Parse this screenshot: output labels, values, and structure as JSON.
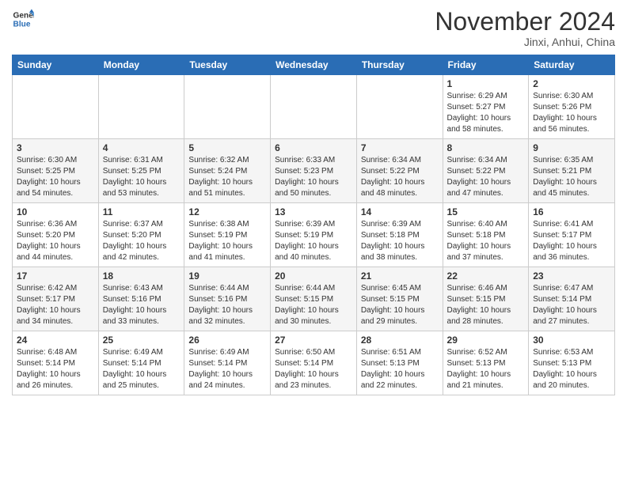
{
  "header": {
    "logo_line1": "General",
    "logo_line2": "Blue",
    "month": "November 2024",
    "location": "Jinxi, Anhui, China"
  },
  "weekdays": [
    "Sunday",
    "Monday",
    "Tuesday",
    "Wednesday",
    "Thursday",
    "Friday",
    "Saturday"
  ],
  "weeks": [
    [
      {
        "day": "",
        "info": ""
      },
      {
        "day": "",
        "info": ""
      },
      {
        "day": "",
        "info": ""
      },
      {
        "day": "",
        "info": ""
      },
      {
        "day": "",
        "info": ""
      },
      {
        "day": "1",
        "info": "Sunrise: 6:29 AM\nSunset: 5:27 PM\nDaylight: 10 hours\nand 58 minutes."
      },
      {
        "day": "2",
        "info": "Sunrise: 6:30 AM\nSunset: 5:26 PM\nDaylight: 10 hours\nand 56 minutes."
      }
    ],
    [
      {
        "day": "3",
        "info": "Sunrise: 6:30 AM\nSunset: 5:25 PM\nDaylight: 10 hours\nand 54 minutes."
      },
      {
        "day": "4",
        "info": "Sunrise: 6:31 AM\nSunset: 5:25 PM\nDaylight: 10 hours\nand 53 minutes."
      },
      {
        "day": "5",
        "info": "Sunrise: 6:32 AM\nSunset: 5:24 PM\nDaylight: 10 hours\nand 51 minutes."
      },
      {
        "day": "6",
        "info": "Sunrise: 6:33 AM\nSunset: 5:23 PM\nDaylight: 10 hours\nand 50 minutes."
      },
      {
        "day": "7",
        "info": "Sunrise: 6:34 AM\nSunset: 5:22 PM\nDaylight: 10 hours\nand 48 minutes."
      },
      {
        "day": "8",
        "info": "Sunrise: 6:34 AM\nSunset: 5:22 PM\nDaylight: 10 hours\nand 47 minutes."
      },
      {
        "day": "9",
        "info": "Sunrise: 6:35 AM\nSunset: 5:21 PM\nDaylight: 10 hours\nand 45 minutes."
      }
    ],
    [
      {
        "day": "10",
        "info": "Sunrise: 6:36 AM\nSunset: 5:20 PM\nDaylight: 10 hours\nand 44 minutes."
      },
      {
        "day": "11",
        "info": "Sunrise: 6:37 AM\nSunset: 5:20 PM\nDaylight: 10 hours\nand 42 minutes."
      },
      {
        "day": "12",
        "info": "Sunrise: 6:38 AM\nSunset: 5:19 PM\nDaylight: 10 hours\nand 41 minutes."
      },
      {
        "day": "13",
        "info": "Sunrise: 6:39 AM\nSunset: 5:19 PM\nDaylight: 10 hours\nand 40 minutes."
      },
      {
        "day": "14",
        "info": "Sunrise: 6:39 AM\nSunset: 5:18 PM\nDaylight: 10 hours\nand 38 minutes."
      },
      {
        "day": "15",
        "info": "Sunrise: 6:40 AM\nSunset: 5:18 PM\nDaylight: 10 hours\nand 37 minutes."
      },
      {
        "day": "16",
        "info": "Sunrise: 6:41 AM\nSunset: 5:17 PM\nDaylight: 10 hours\nand 36 minutes."
      }
    ],
    [
      {
        "day": "17",
        "info": "Sunrise: 6:42 AM\nSunset: 5:17 PM\nDaylight: 10 hours\nand 34 minutes."
      },
      {
        "day": "18",
        "info": "Sunrise: 6:43 AM\nSunset: 5:16 PM\nDaylight: 10 hours\nand 33 minutes."
      },
      {
        "day": "19",
        "info": "Sunrise: 6:44 AM\nSunset: 5:16 PM\nDaylight: 10 hours\nand 32 minutes."
      },
      {
        "day": "20",
        "info": "Sunrise: 6:44 AM\nSunset: 5:15 PM\nDaylight: 10 hours\nand 30 minutes."
      },
      {
        "day": "21",
        "info": "Sunrise: 6:45 AM\nSunset: 5:15 PM\nDaylight: 10 hours\nand 29 minutes."
      },
      {
        "day": "22",
        "info": "Sunrise: 6:46 AM\nSunset: 5:15 PM\nDaylight: 10 hours\nand 28 minutes."
      },
      {
        "day": "23",
        "info": "Sunrise: 6:47 AM\nSunset: 5:14 PM\nDaylight: 10 hours\nand 27 minutes."
      }
    ],
    [
      {
        "day": "24",
        "info": "Sunrise: 6:48 AM\nSunset: 5:14 PM\nDaylight: 10 hours\nand 26 minutes."
      },
      {
        "day": "25",
        "info": "Sunrise: 6:49 AM\nSunset: 5:14 PM\nDaylight: 10 hours\nand 25 minutes."
      },
      {
        "day": "26",
        "info": "Sunrise: 6:49 AM\nSunset: 5:14 PM\nDaylight: 10 hours\nand 24 minutes."
      },
      {
        "day": "27",
        "info": "Sunrise: 6:50 AM\nSunset: 5:14 PM\nDaylight: 10 hours\nand 23 minutes."
      },
      {
        "day": "28",
        "info": "Sunrise: 6:51 AM\nSunset: 5:13 PM\nDaylight: 10 hours\nand 22 minutes."
      },
      {
        "day": "29",
        "info": "Sunrise: 6:52 AM\nSunset: 5:13 PM\nDaylight: 10 hours\nand 21 minutes."
      },
      {
        "day": "30",
        "info": "Sunrise: 6:53 AM\nSunset: 5:13 PM\nDaylight: 10 hours\nand 20 minutes."
      }
    ]
  ]
}
